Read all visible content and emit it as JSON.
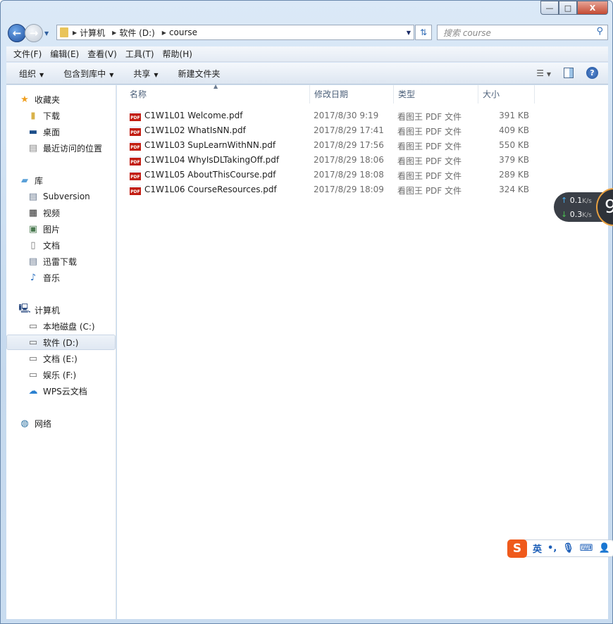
{
  "window": {
    "controls": {
      "minimize": "—",
      "maximize": "□",
      "close": "X"
    }
  },
  "address": {
    "crumbs": [
      "计算机",
      "软件 (D:)",
      "course"
    ]
  },
  "search": {
    "placeholder": "搜索 course"
  },
  "menu": [
    "文件(F)",
    "编辑(E)",
    "查看(V)",
    "工具(T)",
    "帮助(H)"
  ],
  "toolbar": {
    "organize": "组织",
    "include": "包含到库中",
    "share": "共享",
    "new_folder": "新建文件夹",
    "help": "?"
  },
  "sidebar": {
    "favorites": {
      "label": "收藏夹",
      "items": [
        "下载",
        "桌面",
        "最近访问的位置"
      ]
    },
    "libraries": {
      "label": "库",
      "items": [
        "Subversion",
        "视频",
        "图片",
        "文档",
        "迅雷下载",
        "音乐"
      ]
    },
    "computer": {
      "label": "计算机",
      "items": [
        "本地磁盘 (C:)",
        "软件 (D:)",
        "文档 (E:)",
        "娱乐 (F:)",
        "WPS云文档"
      ],
      "selected": "软件 (D:)"
    },
    "network": {
      "label": "网络"
    }
  },
  "columns": {
    "name": "名称",
    "date": "修改日期",
    "type": "类型",
    "size": "大小"
  },
  "files": [
    {
      "name": "C1W1L01 Welcome.pdf",
      "date": "2017/8/30 9:19",
      "type": "看图王 PDF 文件",
      "size": "391 KB"
    },
    {
      "name": "C1W1L02 WhatIsNN.pdf",
      "date": "2017/8/29 17:41",
      "type": "看图王 PDF 文件",
      "size": "409 KB"
    },
    {
      "name": "C1W1L03 SupLearnWithNN.pdf",
      "date": "2017/8/29 17:56",
      "type": "看图王 PDF 文件",
      "size": "550 KB"
    },
    {
      "name": "C1W1L04 WhyIsDLTakingOff.pdf",
      "date": "2017/8/29 18:06",
      "type": "看图王 PDF 文件",
      "size": "379 KB"
    },
    {
      "name": "C1W1L05 AboutThisCourse.pdf",
      "date": "2017/8/29 18:08",
      "type": "看图王 PDF 文件",
      "size": "289 KB"
    },
    {
      "name": "C1W1L06 CourseResources.pdf",
      "date": "2017/8/29 18:09",
      "type": "看图王 PDF 文件",
      "size": "324 KB"
    }
  ],
  "net_monitor": {
    "up": "0.1",
    "down": "0.3",
    "unit": "K/s",
    "gauge": "9"
  },
  "ime": {
    "logo": "S",
    "mode": "英",
    "punct": "•,"
  }
}
